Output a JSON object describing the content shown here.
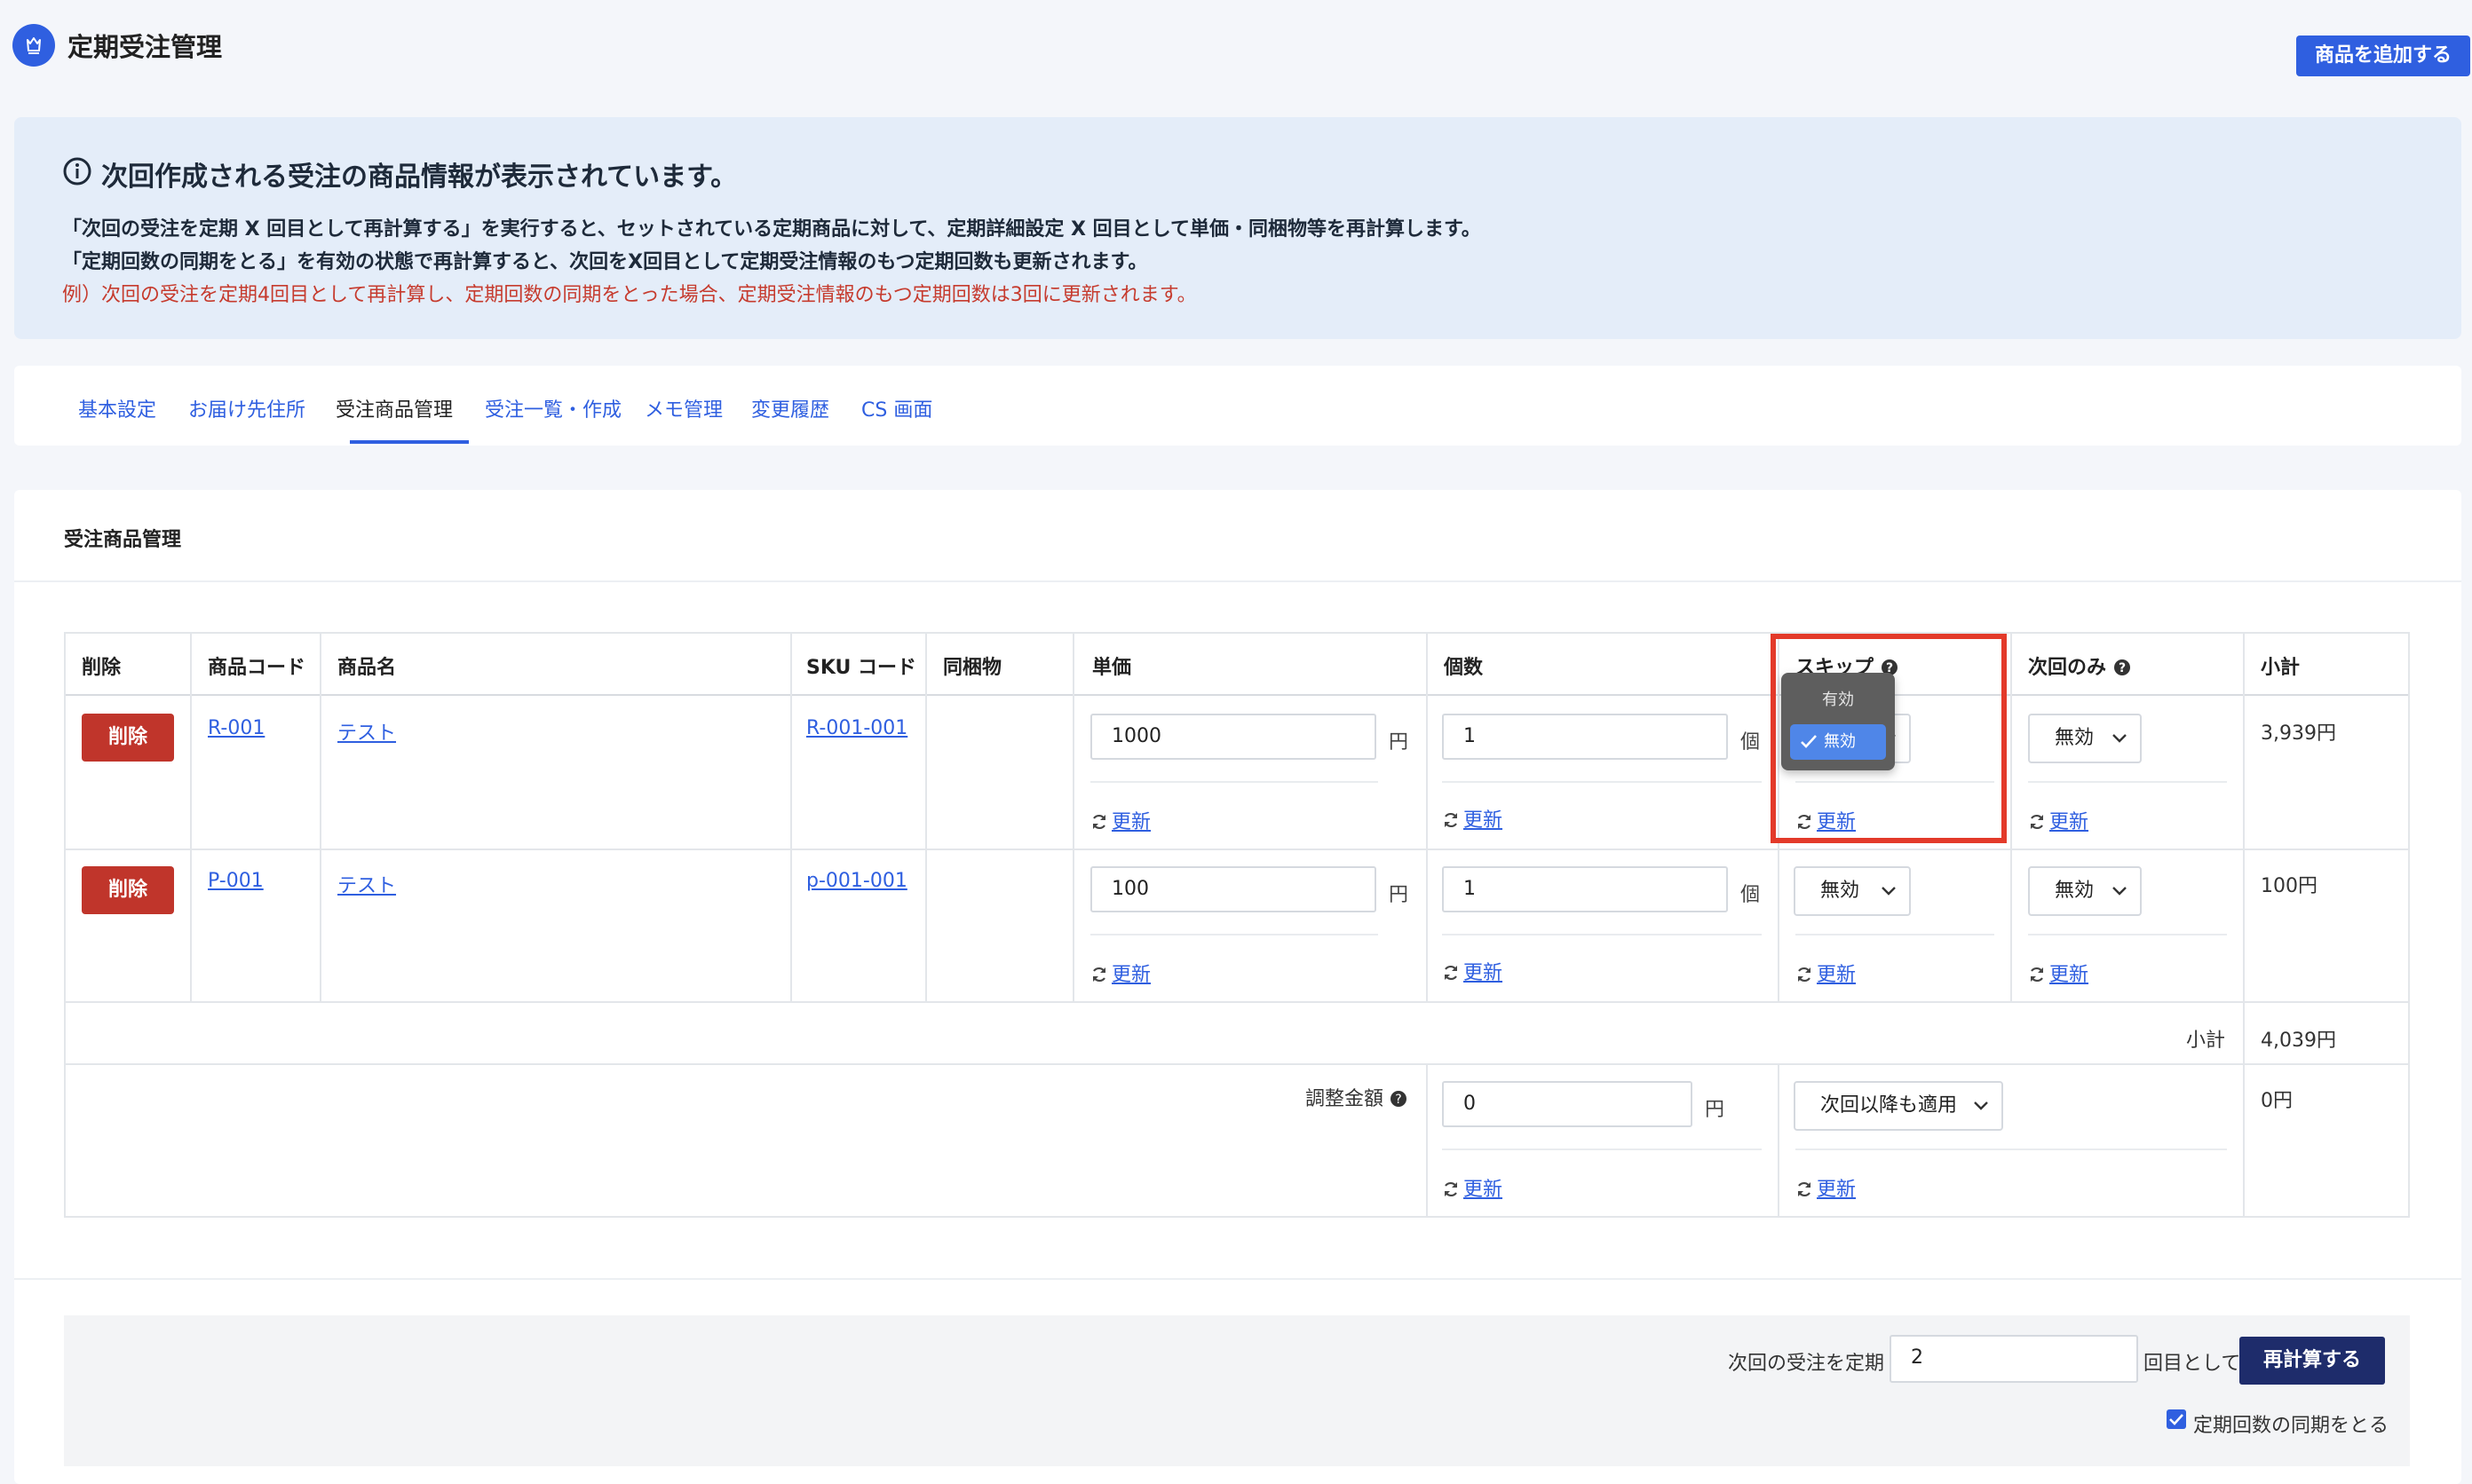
{
  "header": {
    "title": "定期受注管理",
    "add_button": "商品を追加する"
  },
  "info": {
    "title": "次回作成される受注の商品情報が表示されています。",
    "line1": "「次回の受注を定期 X 回目として再計算する」を実行すると、セットされている定期商品に対して、定期詳細設定 X 回目として単価・同梱物等を再計算します。",
    "line2": "「定期回数の同期をとる」を有効の状態で再計算すると、次回をX回目として定期受注情報のもつ定期回数も更新されます。",
    "line3": "例）次回の受注を定期4回目として再計算し、定期回数の同期をとった場合、定期受注情報のもつ定期回数は3回に更新されます。",
    "accent_color": "#c63b2e"
  },
  "tabs": [
    {
      "label": "基本設定"
    },
    {
      "label": "お届け先住所"
    },
    {
      "label": "受注商品管理"
    },
    {
      "label": "受注一覧・作成"
    },
    {
      "label": "メモ管理"
    },
    {
      "label": "変更履歴"
    },
    {
      "label": "CS 画面"
    }
  ],
  "active_tab": "受注商品管理",
  "panel": {
    "title": "受注商品管理"
  },
  "table": {
    "headers": {
      "delete": "削除",
      "code": "商品コード",
      "name": "商品名",
      "sku": "SKU コード",
      "bundle": "同梱物",
      "price": "単価",
      "qty": "個数",
      "skip": "スキップ",
      "next_only": "次回のみ",
      "subtotal": "小計"
    },
    "delete_label": "削除",
    "update_label": "更新",
    "yen": "円",
    "piece": "個",
    "rows": [
      {
        "code": "R-001",
        "name": "テスト",
        "sku": "R-001-001",
        "price": "1000",
        "qty": "1",
        "skip": "無効",
        "next_only": "無効",
        "subtotal": "3,939円"
      },
      {
        "code": "P-001",
        "name": "テスト",
        "sku": "p-001-001",
        "price": "100",
        "qty": "1",
        "skip": "無効",
        "next_only": "無効",
        "subtotal": "100円"
      }
    ],
    "subtotal_label": "小計",
    "subtotal_value": "4,039円",
    "adjust_label": "調整金額",
    "adjust_value": "0",
    "adjust_apply": "次回以降も適用",
    "adjust_subtotal": "0円"
  },
  "skip_dropdown": {
    "options": [
      "有効",
      "無効"
    ],
    "selected": "無効"
  },
  "recalc": {
    "prefix": "次回の受注を定期",
    "value": "2",
    "suffix": "回目として",
    "button": "再計算する",
    "sync_label": "定期回数の同期をとる",
    "sync_checked": true
  },
  "colors": {
    "primary": "#2f5fe0",
    "danger": "#c0352b",
    "dark_button": "#1e2c6b",
    "highlight": "#e33a2a"
  }
}
